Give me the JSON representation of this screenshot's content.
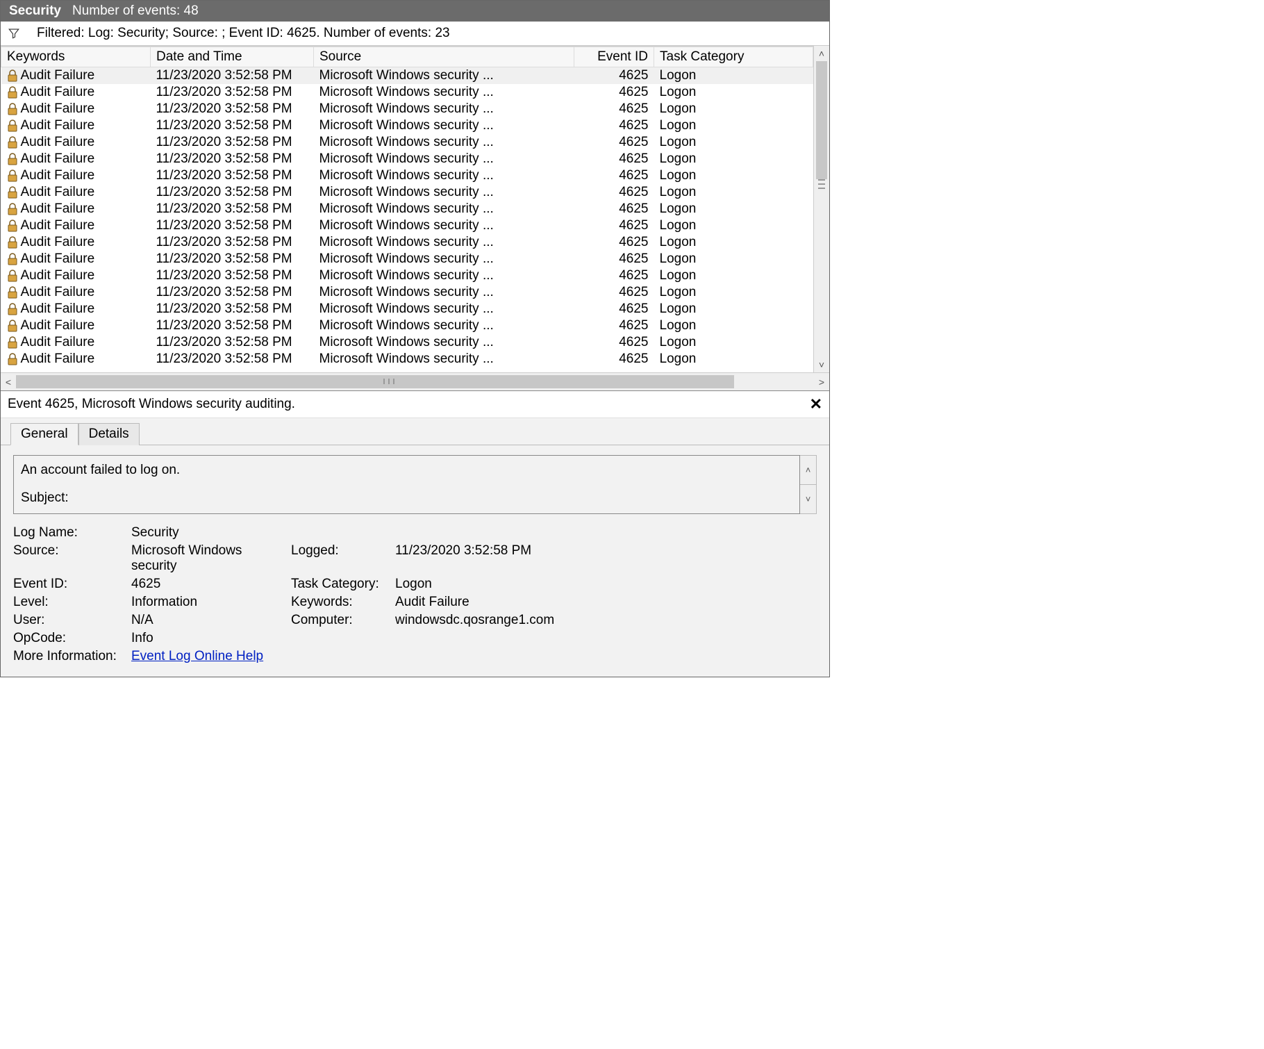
{
  "header": {
    "title": "Security",
    "subtitle": "Number of events: 48"
  },
  "filter": {
    "text": "Filtered: Log: Security; Source: ; Event ID: 4625. Number of events: 23"
  },
  "columns": {
    "keywords": "Keywords",
    "datetime": "Date and Time",
    "source": "Source",
    "eventid": "Event ID",
    "taskcat": "Task Category"
  },
  "rows": [
    {
      "keywords": "Audit Failure",
      "datetime": "11/23/2020 3:52:58 PM",
      "source": "Microsoft Windows security ...",
      "eventid": "4625",
      "taskcat": "Logon"
    },
    {
      "keywords": "Audit Failure",
      "datetime": "11/23/2020 3:52:58 PM",
      "source": "Microsoft Windows security ...",
      "eventid": "4625",
      "taskcat": "Logon"
    },
    {
      "keywords": "Audit Failure",
      "datetime": "11/23/2020 3:52:58 PM",
      "source": "Microsoft Windows security ...",
      "eventid": "4625",
      "taskcat": "Logon"
    },
    {
      "keywords": "Audit Failure",
      "datetime": "11/23/2020 3:52:58 PM",
      "source": "Microsoft Windows security ...",
      "eventid": "4625",
      "taskcat": "Logon"
    },
    {
      "keywords": "Audit Failure",
      "datetime": "11/23/2020 3:52:58 PM",
      "source": "Microsoft Windows security ...",
      "eventid": "4625",
      "taskcat": "Logon"
    },
    {
      "keywords": "Audit Failure",
      "datetime": "11/23/2020 3:52:58 PM",
      "source": "Microsoft Windows security ...",
      "eventid": "4625",
      "taskcat": "Logon"
    },
    {
      "keywords": "Audit Failure",
      "datetime": "11/23/2020 3:52:58 PM",
      "source": "Microsoft Windows security ...",
      "eventid": "4625",
      "taskcat": "Logon"
    },
    {
      "keywords": "Audit Failure",
      "datetime": "11/23/2020 3:52:58 PM",
      "source": "Microsoft Windows security ...",
      "eventid": "4625",
      "taskcat": "Logon"
    },
    {
      "keywords": "Audit Failure",
      "datetime": "11/23/2020 3:52:58 PM",
      "source": "Microsoft Windows security ...",
      "eventid": "4625",
      "taskcat": "Logon"
    },
    {
      "keywords": "Audit Failure",
      "datetime": "11/23/2020 3:52:58 PM",
      "source": "Microsoft Windows security ...",
      "eventid": "4625",
      "taskcat": "Logon"
    },
    {
      "keywords": "Audit Failure",
      "datetime": "11/23/2020 3:52:58 PM",
      "source": "Microsoft Windows security ...",
      "eventid": "4625",
      "taskcat": "Logon"
    },
    {
      "keywords": "Audit Failure",
      "datetime": "11/23/2020 3:52:58 PM",
      "source": "Microsoft Windows security ...",
      "eventid": "4625",
      "taskcat": "Logon"
    },
    {
      "keywords": "Audit Failure",
      "datetime": "11/23/2020 3:52:58 PM",
      "source": "Microsoft Windows security ...",
      "eventid": "4625",
      "taskcat": "Logon"
    },
    {
      "keywords": "Audit Failure",
      "datetime": "11/23/2020 3:52:58 PM",
      "source": "Microsoft Windows security ...",
      "eventid": "4625",
      "taskcat": "Logon"
    },
    {
      "keywords": "Audit Failure",
      "datetime": "11/23/2020 3:52:58 PM",
      "source": "Microsoft Windows security ...",
      "eventid": "4625",
      "taskcat": "Logon"
    },
    {
      "keywords": "Audit Failure",
      "datetime": "11/23/2020 3:52:58 PM",
      "source": "Microsoft Windows security ...",
      "eventid": "4625",
      "taskcat": "Logon"
    },
    {
      "keywords": "Audit Failure",
      "datetime": "11/23/2020 3:52:58 PM",
      "source": "Microsoft Windows security ...",
      "eventid": "4625",
      "taskcat": "Logon"
    },
    {
      "keywords": "Audit Failure",
      "datetime": "11/23/2020 3:52:58 PM",
      "source": "Microsoft Windows security ...",
      "eventid": "4625",
      "taskcat": "Logon"
    }
  ],
  "detail": {
    "title": "Event 4625, Microsoft Windows security auditing.",
    "tabs": {
      "general": "General",
      "details": "Details"
    },
    "message_line1": "An account failed to log on.",
    "message_line2": "Subject:",
    "labels": {
      "logname": "Log Name:",
      "source": "Source:",
      "eventid": "Event ID:",
      "level": "Level:",
      "user": "User:",
      "opcode": "OpCode:",
      "moreinfo": "More Information:",
      "logged": "Logged:",
      "taskcat": "Task Category:",
      "keywords": "Keywords:",
      "computer": "Computer:"
    },
    "values": {
      "logname": "Security",
      "source": "Microsoft Windows security",
      "eventid": "4625",
      "level": "Information",
      "user": "N/A",
      "opcode": "Info",
      "moreinfo_link": "Event Log Online Help",
      "logged": "11/23/2020 3:52:58 PM",
      "taskcat": "Logon",
      "keywords": "Audit Failure",
      "computer": "windowsdc.qosrange1.com"
    }
  }
}
